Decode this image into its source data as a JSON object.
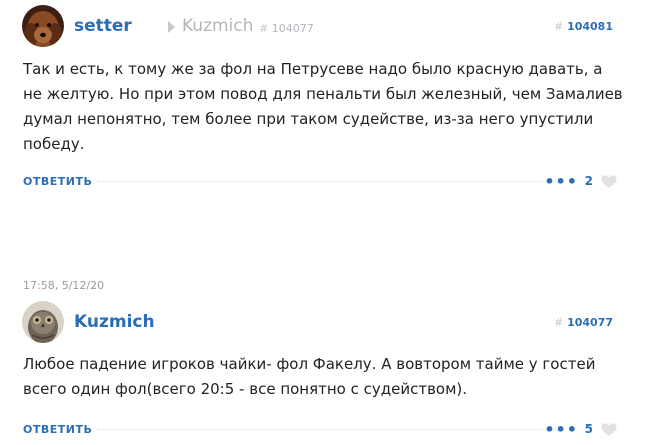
{
  "comment1": {
    "author": "setter",
    "reply_to_author": "Kuzmich",
    "reply_to_id": "104077",
    "id": "104081",
    "text": "Так и есть, к тому же за фол на Петрусеве надо было красную давать, а не желтую. Но при этом повод для пенальти был железный, чем Замалиев думал непонятно, тем более при таком судействе, из-за него упустили победу.",
    "reply_label": "ОТВЕТИТЬ",
    "more_label": "•••",
    "likes": "2"
  },
  "comment2": {
    "timestamp": "17:58, 5/12/20",
    "author": "Kuzmich",
    "id": "104077",
    "text": "Любое падение игроков чайки- фол Факелу. А вовтором тайме у гостей всего один фол(всего 20:5 - все понятно с судейством).",
    "reply_label": "ОТВЕТИТЬ",
    "more_label": "•••",
    "likes": "5"
  },
  "icons": {
    "hash": "#",
    "heart": "heart-icon",
    "reply_arrow": "caret-right-icon"
  }
}
